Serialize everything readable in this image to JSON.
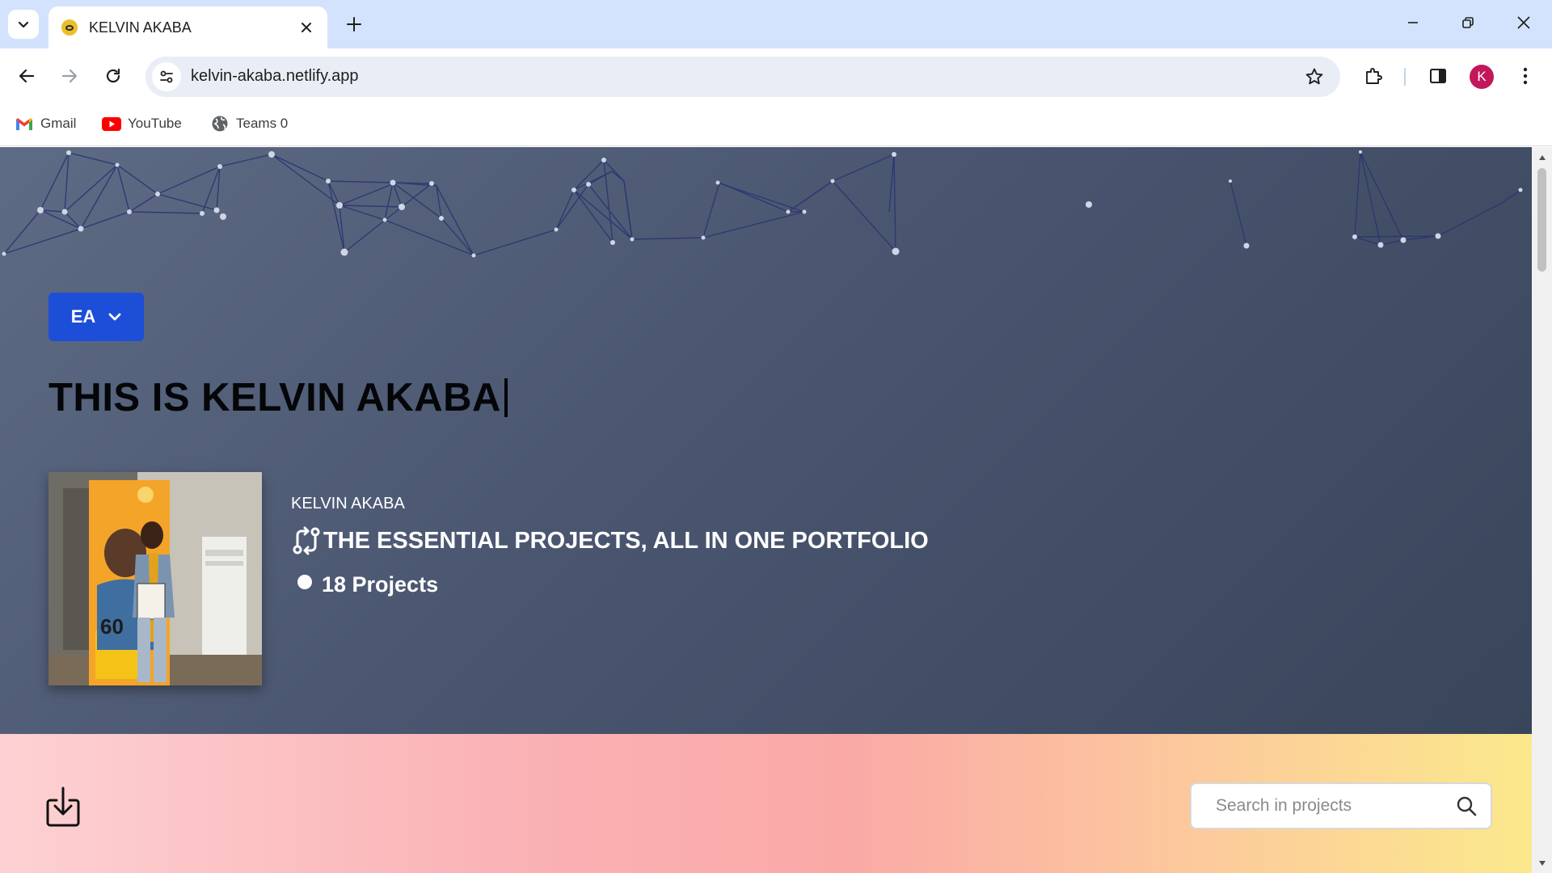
{
  "browser": {
    "tab_title": "KELVIN AKABA",
    "url": "kelvin-akaba.netlify.app",
    "profile_initial": "K",
    "bookmarks": [
      {
        "label": "Gmail",
        "icon": "gmail-icon"
      },
      {
        "label": "YouTube",
        "icon": "youtube-icon"
      },
      {
        "label": "Teams 0",
        "icon": "globe-icon"
      }
    ]
  },
  "hero": {
    "menu_label": "EA",
    "headline": "THIS IS KELVIN AKABA",
    "profile_name": "KELVIN AKABA",
    "tagline": "THE ESSENTIAL PROJECTS, ALL IN ONE PORTFOLIO",
    "projects_count": "18 Projects"
  },
  "toolbar": {
    "search_placeholder": "Search in projects"
  },
  "colors": {
    "accent": "#1d4ed8",
    "hero_bg_start": "#5e6b85",
    "hero_bg_end": "#39455a",
    "network_line": "#2c3570",
    "avatar": "#c2185b"
  }
}
